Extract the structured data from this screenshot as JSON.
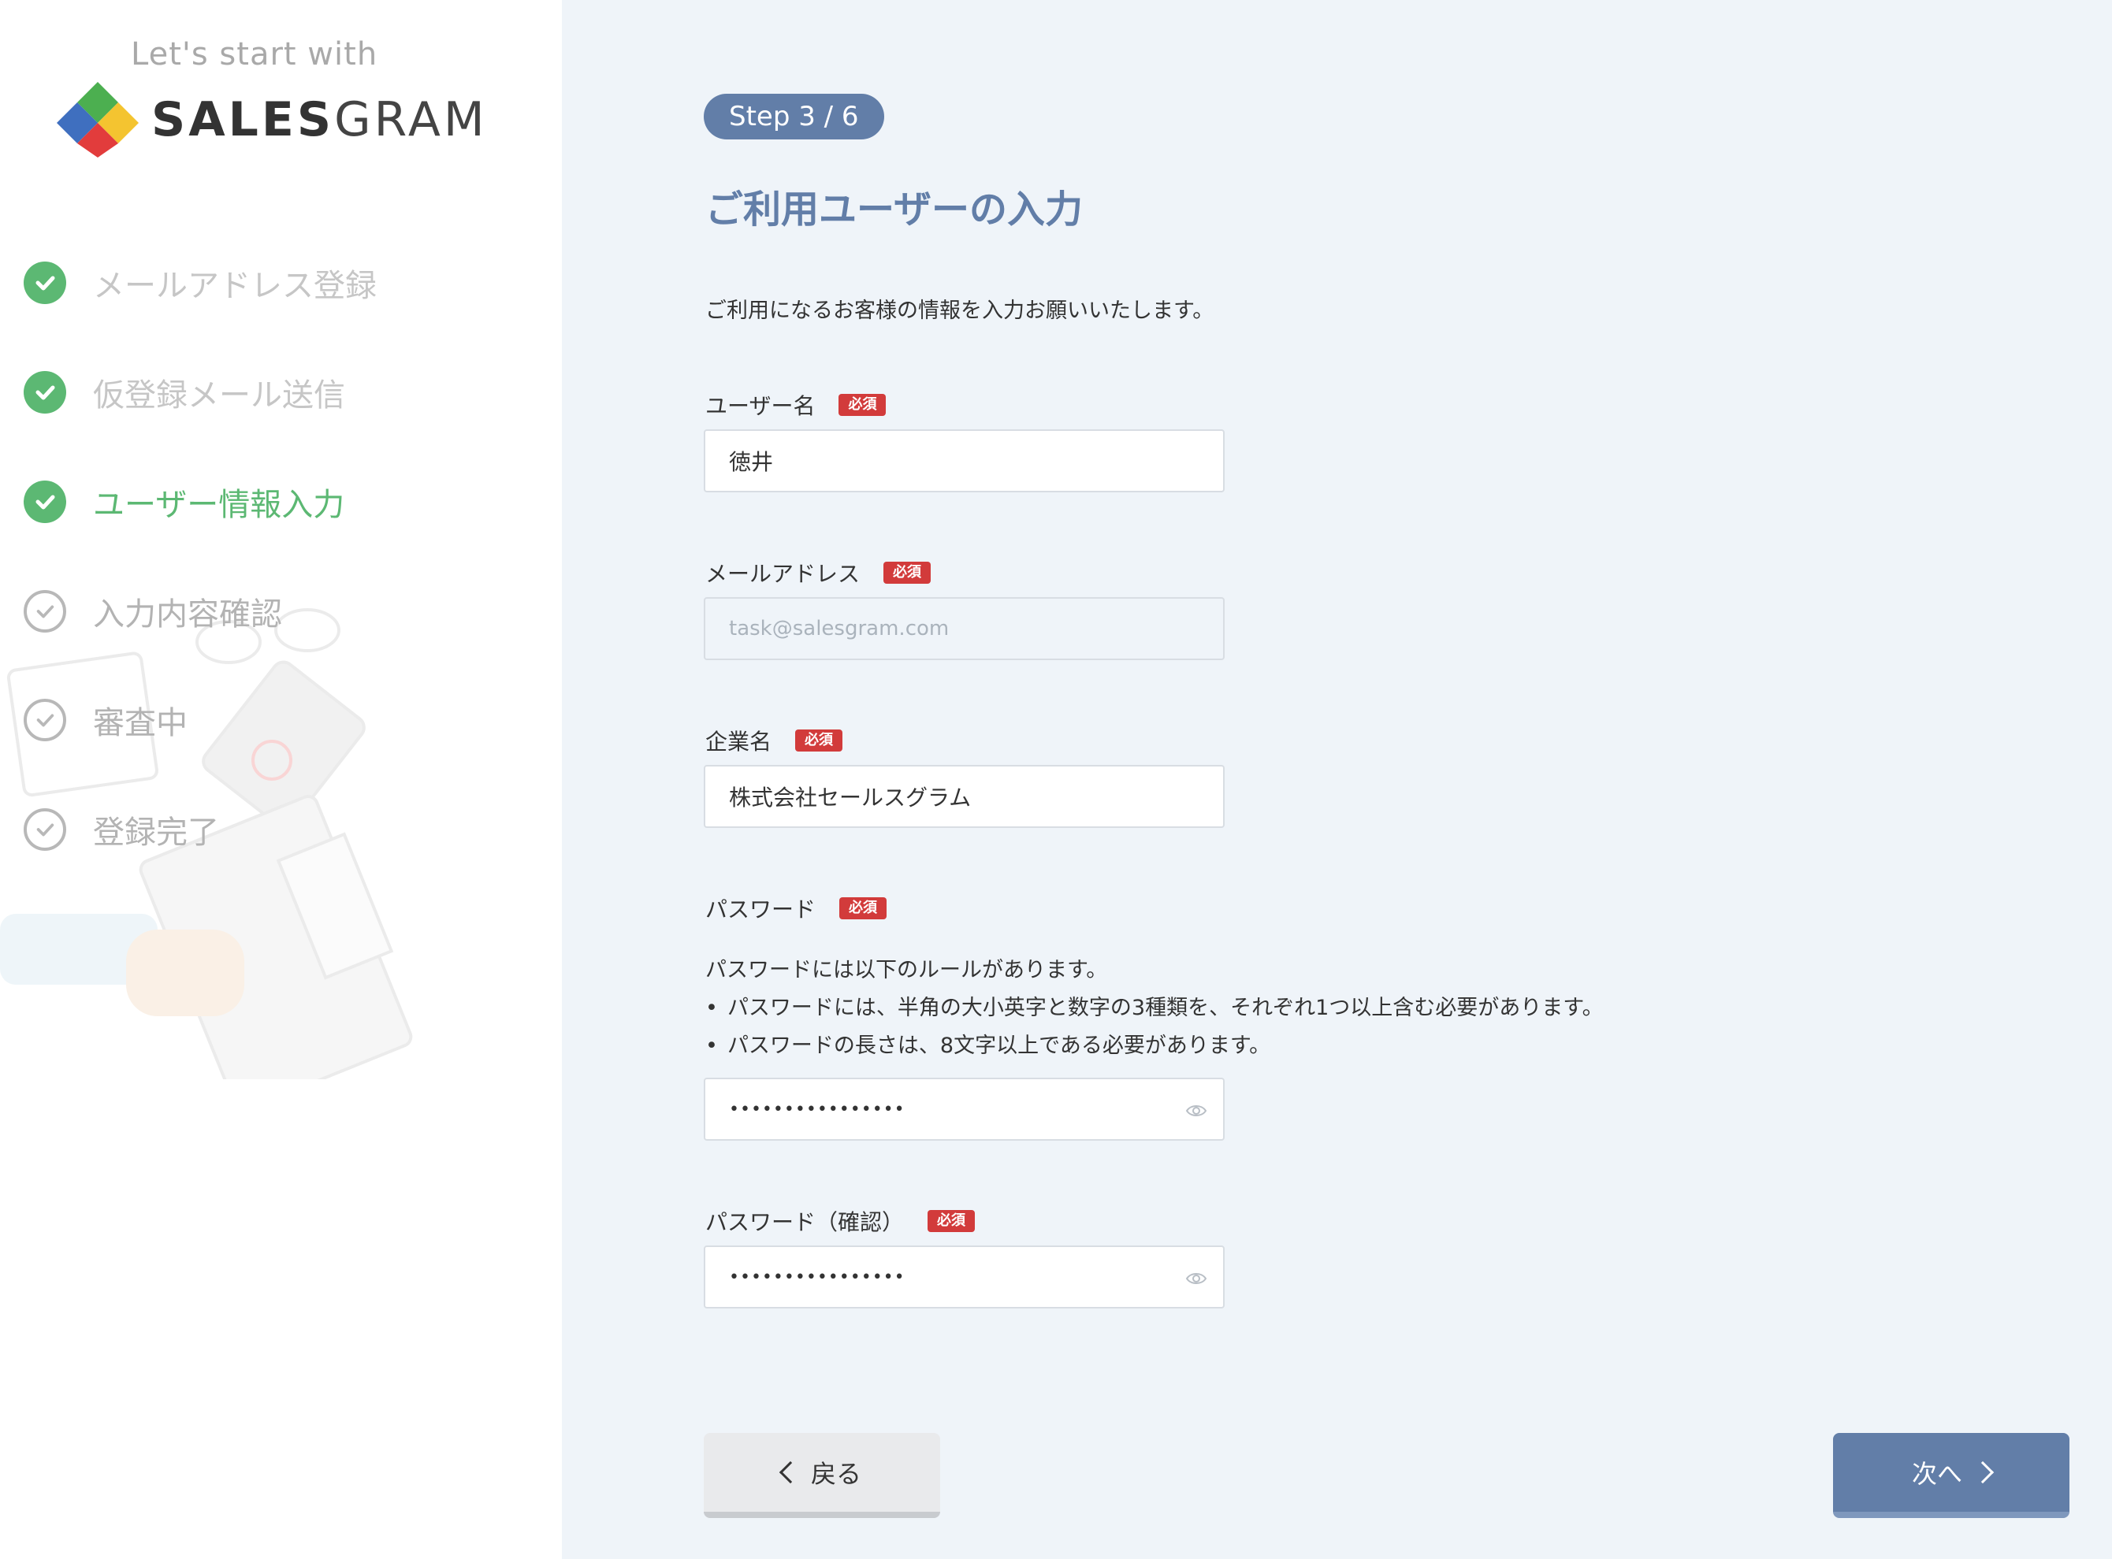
{
  "sidebar": {
    "tagline": "Let's start with",
    "logo": {
      "bold": "SALES",
      "light": "GRAM"
    },
    "steps": [
      {
        "label": "メールアドレス登録",
        "state": "done"
      },
      {
        "label": "仮登録メール送信",
        "state": "done"
      },
      {
        "label": "ユーザー情報入力",
        "state": "current"
      },
      {
        "label": "入力内容確認",
        "state": "todo"
      },
      {
        "label": "審査中",
        "state": "todo"
      },
      {
        "label": "登録完了",
        "state": "todo"
      }
    ]
  },
  "main": {
    "step_badge": "Step 3 / 6",
    "title": "ご利用ユーザーの入力",
    "intro": "ご利用になるお客様の情報を入力お願いいたします。",
    "required_label": "必須",
    "fields": {
      "username": {
        "label": "ユーザー名",
        "value": "徳井"
      },
      "email": {
        "label": "メールアドレス",
        "placeholder": "task@salesgram.com"
      },
      "company": {
        "label": "企業名",
        "value": "株式会社セールスグラム"
      },
      "password": {
        "label": "パスワード",
        "value": "••••••••••••••••"
      },
      "password_confirm": {
        "label": "パスワード（確認）",
        "value": "••••••••••••••••"
      }
    },
    "password_rules": {
      "heading": "パスワードには以下のルールがあります。",
      "items": [
        "パスワードには、半角の大小英字と数字の3種類を、それぞれ1つ以上含む必要があります。",
        "パスワードの長さは、8文字以上である必要があります。"
      ]
    },
    "buttons": {
      "back": "戻る",
      "next": "次へ"
    }
  },
  "colors": {
    "accent": "#627ea8",
    "success": "#5cb873",
    "required": "#d23b3b",
    "background": "#eff4f9"
  },
  "icons": {
    "check": "check-icon",
    "eye": "eye-icon",
    "chevron_left": "chevron-left-icon",
    "chevron_right": "chevron-right-icon"
  }
}
